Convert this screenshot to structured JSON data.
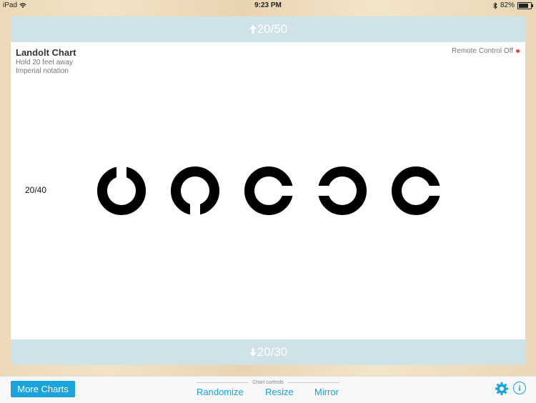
{
  "status": {
    "device": "iPad",
    "time": "9:23 PM",
    "battery": "82%",
    "battery_level": 0.82
  },
  "nav": {
    "up_label": "20/50",
    "down_label": "20/30"
  },
  "chart": {
    "title": "Landolt Chart",
    "line1": "Hold 20 feet away",
    "line2": "Imperial notation",
    "remote": "Remote Control Off",
    "acuity": "20/40",
    "optotypes": [
      {
        "gap": "up"
      },
      {
        "gap": "down"
      },
      {
        "gap": "right"
      },
      {
        "gap": "left"
      },
      {
        "gap": "right"
      }
    ]
  },
  "toolbar": {
    "more": "More Charts",
    "controls_caption": "Chart controls",
    "randomize": "Randomize",
    "resize": "Resize",
    "mirror": "Mirror",
    "info": "i"
  },
  "colors": {
    "accent": "#1aa3dd",
    "nav_bg": "#cfe2e8",
    "remote_dot": "#e0413e"
  },
  "icons": [
    "wifi-icon",
    "bluetooth-icon",
    "battery-icon",
    "arrow-up-icon",
    "arrow-down-icon",
    "gear-icon",
    "info-icon"
  ]
}
